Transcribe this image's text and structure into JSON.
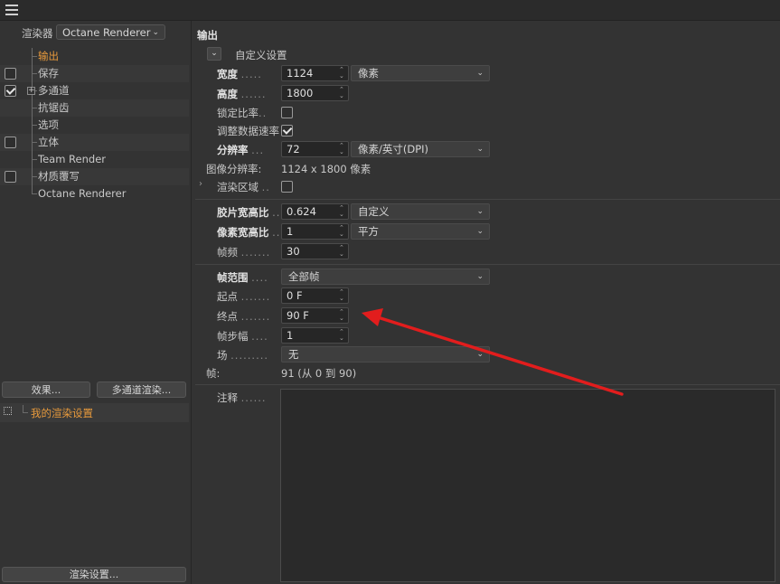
{
  "left": {
    "renderer_label": "渲染器",
    "renderer_value": "Octane Renderer",
    "tree": [
      {
        "label": "输出",
        "checkbox": false,
        "checked": false,
        "selected": true
      },
      {
        "label": "保存",
        "checkbox": true,
        "checked": false,
        "selected": false
      },
      {
        "label": "多通道",
        "checkbox": true,
        "checked": true,
        "selected": false,
        "expander": "+"
      },
      {
        "label": "抗锯齿",
        "checkbox": false,
        "checked": false,
        "selected": false
      },
      {
        "label": "选项",
        "checkbox": false,
        "checked": false,
        "selected": false
      },
      {
        "label": "立体",
        "checkbox": true,
        "checked": false,
        "selected": false
      },
      {
        "label": "Team Render",
        "checkbox": false,
        "checked": false,
        "selected": false
      },
      {
        "label": "材质覆写",
        "checkbox": true,
        "checked": false,
        "selected": false
      },
      {
        "label": "Octane Renderer",
        "checkbox": false,
        "checked": false,
        "selected": false
      }
    ],
    "effects_button": "效果...",
    "multipass_button": "多通道渲染...",
    "preset_label": "我的渲染设置",
    "render_settings_button": "渲染设置..."
  },
  "output": {
    "title": "输出",
    "preset_label": "自定义设置",
    "width_label": "宽度",
    "width_value": "1124",
    "width_unit": "像素",
    "height_label": "高度",
    "height_value": "1800",
    "lock_ratio_label": "锁定比率",
    "adjust_rate_label": "调整数据速率",
    "resolution_label": "分辨率",
    "resolution_value": "72",
    "resolution_unit": "像素/英寸(DPI)",
    "image_res_label": "图像分辨率:",
    "image_res_value": "1124 x 1800 像素",
    "render_region_label": "渲染区域",
    "film_aspect_label": "胶片宽高比",
    "film_aspect_value": "0.624",
    "film_aspect_preset": "自定义",
    "pixel_aspect_label": "像素宽高比",
    "pixel_aspect_value": "1",
    "pixel_aspect_preset": "平方",
    "frame_rate_label": "帧频",
    "frame_rate_value": "30",
    "frame_range_label": "帧范围",
    "frame_range_value": "全部帧",
    "start_label": "起点",
    "start_value": "0 F",
    "end_label": "终点",
    "end_value": "90 F",
    "step_label": "帧步幅",
    "step_value": "1",
    "field_label": "场",
    "field_value": "无",
    "frames_label": "帧:",
    "frames_value": "91 (从 0 到 90)",
    "notes_label": "注释"
  },
  "colors": {
    "accent": "#e89a3c",
    "arrow": "#e21d1d",
    "background": "#333333"
  }
}
